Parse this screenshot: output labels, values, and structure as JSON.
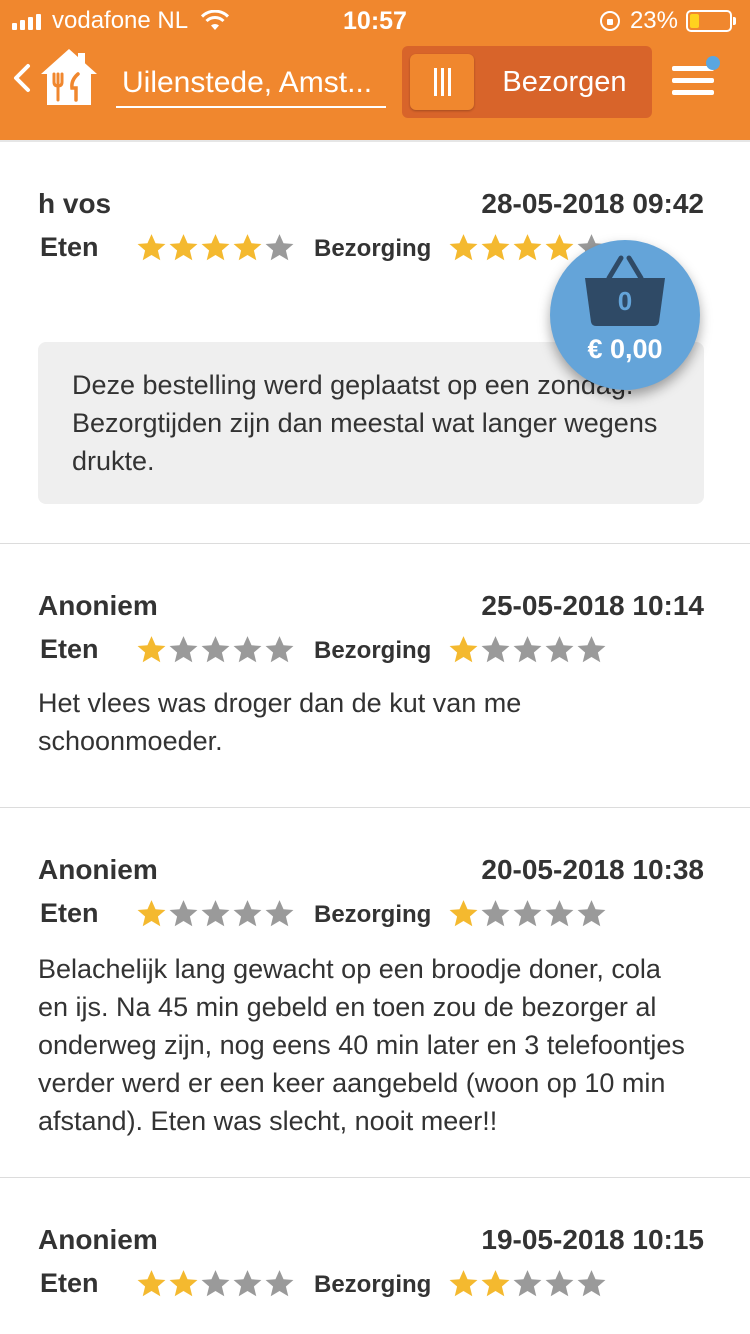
{
  "status_bar": {
    "carrier": "vodafone NL",
    "time": "10:57",
    "battery_percent": "23%",
    "battery_level": 0.23
  },
  "header": {
    "location": "Uilenstede, Amst...",
    "mode_label": "Bezorgen",
    "icons": [
      "back-chevron-icon",
      "restaurant-home-logo",
      "toggle-grip-icon",
      "menu-icon"
    ]
  },
  "reviews": [
    {
      "name": "h vos",
      "date": "28-05-2018 09:42",
      "food_label": "Eten",
      "delivery_label": "Bezorging",
      "food_rating": 4,
      "delivery_rating": 4,
      "notice": "Deze bestelling werd geplaatst op een zondag. Bezorgtijden zijn dan meestal wat langer wegens drukte."
    },
    {
      "name": "Anoniem",
      "date": "25-05-2018 10:14",
      "food_label": "Eten",
      "delivery_label": "Bezorging",
      "food_rating": 1,
      "delivery_rating": 1,
      "text": "Het vlees was droger dan de kut van me schoonmoeder."
    },
    {
      "name": "Anoniem",
      "date": "20-05-2018 10:38",
      "food_label": "Eten",
      "delivery_label": "Bezorging",
      "food_rating": 1,
      "delivery_rating": 1,
      "text": "Belachelijk lang gewacht op een broodje doner, cola en ijs. Na 45 min gebeld en toen zou de bezorger al onderweg zijn, nog eens 40 min later en 3 telefoontjes verder werd er een keer aangebeld (woon op 10 min afstand). Eten was slecht, nooit meer!!"
    },
    {
      "name": "Anoniem",
      "date": "19-05-2018 10:15",
      "food_label": "Eten",
      "delivery_label": "Bezorging",
      "food_rating": 2,
      "delivery_rating": 2
    }
  ],
  "cart": {
    "count": "0",
    "total": "€ 0,00"
  },
  "colors": {
    "brand_orange": "#f0872e",
    "toggle_dark": "#d8642a",
    "star_on": "#f4b92f",
    "star_off": "#9a9a9a",
    "cart_blue": "#64a4d9"
  }
}
